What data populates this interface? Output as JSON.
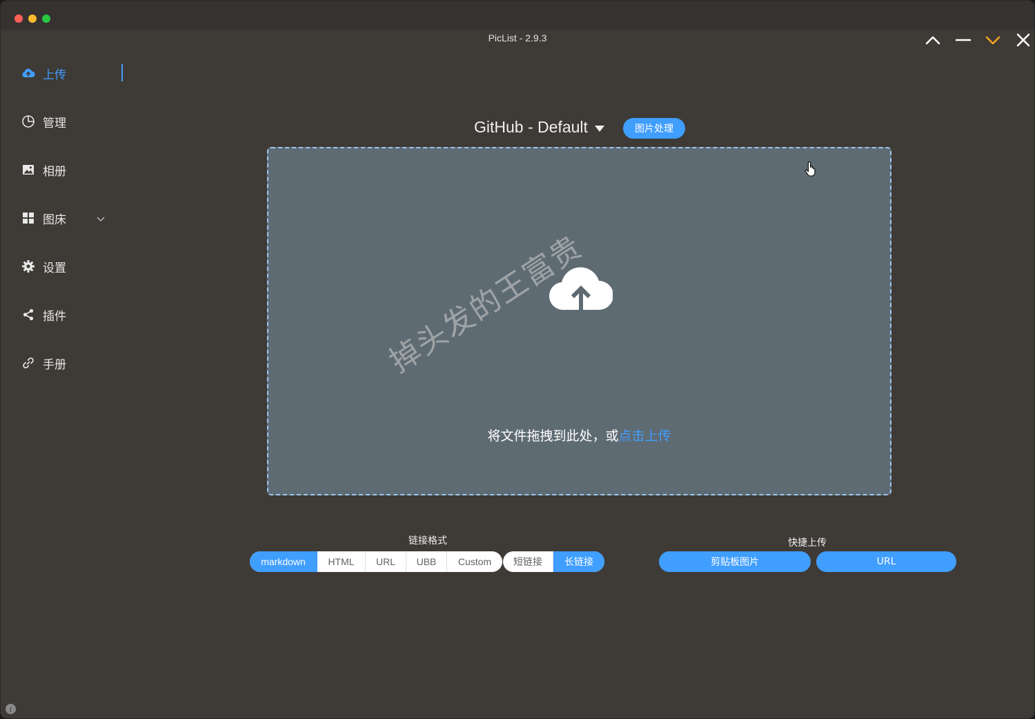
{
  "window": {
    "title": "PicList - 2.9.3"
  },
  "sidebar": {
    "items": [
      {
        "label": "上传",
        "icon": "upload-cloud-icon",
        "active": true
      },
      {
        "label": "管理",
        "icon": "pie-chart-icon"
      },
      {
        "label": "相册",
        "icon": "image-icon"
      },
      {
        "label": "图床",
        "icon": "grid-icon",
        "expandable": true
      },
      {
        "label": "设置",
        "icon": "gear-icon"
      },
      {
        "label": "插件",
        "icon": "share-icon"
      },
      {
        "label": "手册",
        "icon": "link-icon"
      }
    ]
  },
  "upload": {
    "picbed": "GitHub - Default",
    "process_button": "图片处理",
    "drop_text": "将文件拖拽到此处，或",
    "drop_link": "点击上传",
    "watermark": "掉头发的王富贵"
  },
  "link_format": {
    "label": "链接格式",
    "options": [
      "markdown",
      "HTML",
      "URL",
      "UBB",
      "Custom"
    ],
    "selected": "markdown",
    "length_options": [
      "短链接",
      "长链接"
    ],
    "length_selected": "长链接"
  },
  "quick_upload": {
    "label": "快捷上传",
    "buttons": [
      "剪贴板图片",
      "URL"
    ]
  },
  "colors": {
    "accent": "#409eff",
    "background": "#3e3a36",
    "dropzone": "#5f6b73",
    "minimize_accent": "#f5a623"
  }
}
